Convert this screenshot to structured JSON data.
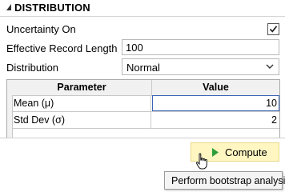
{
  "section": {
    "title": "DISTRIBUTION",
    "collapse_icon": "triangle-down-right-icon"
  },
  "fields": {
    "uncertainty": {
      "label": "Uncertainty On",
      "checked": true
    },
    "record_length": {
      "label": "Effective Record Length",
      "value": "100"
    },
    "distribution": {
      "label": "Distribution",
      "value": "Normal"
    }
  },
  "grid": {
    "headers": {
      "parameter": "Parameter",
      "value": "Value"
    },
    "rows": [
      {
        "parameter": "Mean (μ)",
        "value": "10"
      },
      {
        "parameter": "Std Dev (σ)",
        "value": "2"
      }
    ]
  },
  "compute": {
    "label": "Compute",
    "icon": "play-icon",
    "bg": "#fff6c2"
  },
  "tooltip": {
    "text": "Perform bootstrap analysis"
  },
  "colors": {
    "accent_green": "#2e9e3a",
    "selection_border": "#3b64b7"
  }
}
